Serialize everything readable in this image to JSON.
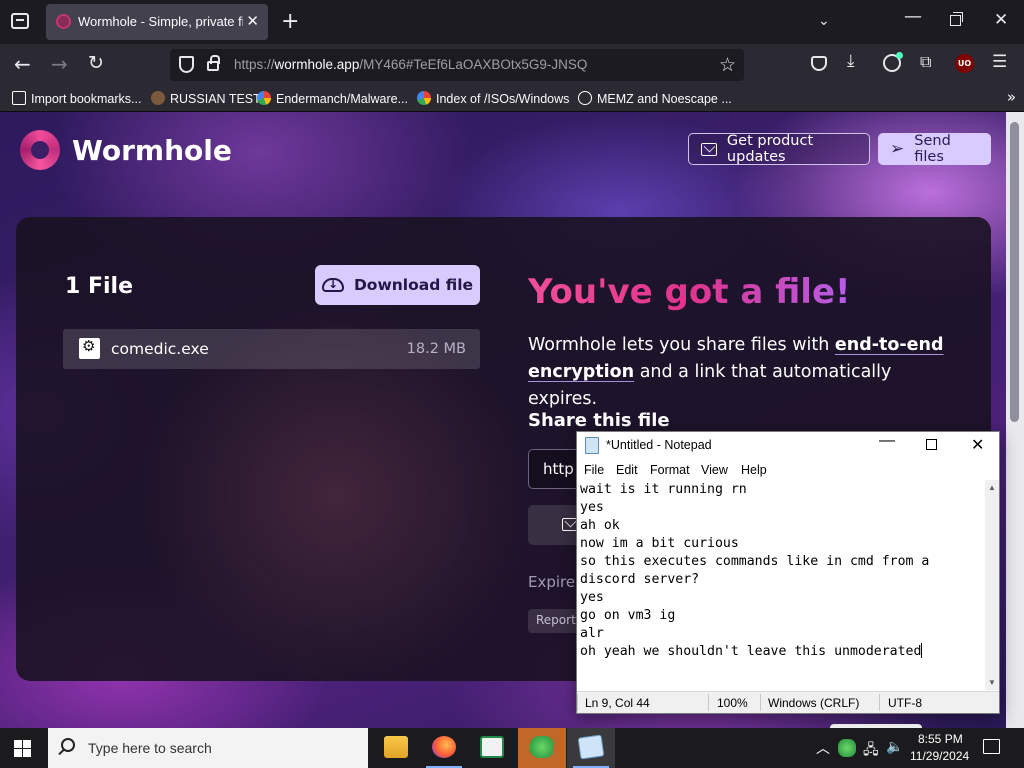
{
  "browser": {
    "tab_title": "Wormhole - Simple, private file sharing",
    "url_scheme": "https://",
    "url_host": "wormhole.app",
    "url_path": "/MY466#TeEf6LaOAXBOtx5G9-JNSQ",
    "bookmarks": [
      "Import bookmarks...",
      "RUSSIAN TEST",
      "Endermanch/Malware...",
      "Index of /ISOs/Windows",
      "MEMZ and Noescape ..."
    ],
    "bookmarks_more": "»",
    "ublock_badge": "UO"
  },
  "site": {
    "brand": "Wormhole",
    "updates_button": "Get product updates",
    "send_button": "Send files",
    "files_count": "1 File",
    "download_button": "Download file",
    "file": {
      "name": "comedic.exe",
      "size": "18.2 MB"
    },
    "headline": "You've got a file!",
    "description_before": "Wormhole lets you share files with ",
    "description_link": "end-to-end encryption",
    "description_after": " and a link that automatically expires.",
    "share_title": "Share this file",
    "share_link_partial": "http",
    "expires_partial": "Expires",
    "report_partial": "Report"
  },
  "notepad": {
    "title": "*Untitled - Notepad",
    "menu": [
      "File",
      "Edit",
      "Format",
      "View",
      "Help"
    ],
    "lines": [
      "wait is it running rn",
      "yes",
      "ah ok",
      "now im a bit curious",
      "so this executes commands like in cmd from a",
      "discord server?",
      "yes",
      "go on vm3 ig",
      "alr",
      "oh yeah we shouldn't leave this unmoderated"
    ],
    "status": {
      "position": "Ln 9, Col 44",
      "zoom": "100%",
      "line_ending": "Windows (CRLF)",
      "encoding": "UTF-8"
    }
  },
  "taskbar": {
    "search_placeholder": "Type here to search",
    "time": "8:55 PM",
    "date": "11/29/2024"
  }
}
